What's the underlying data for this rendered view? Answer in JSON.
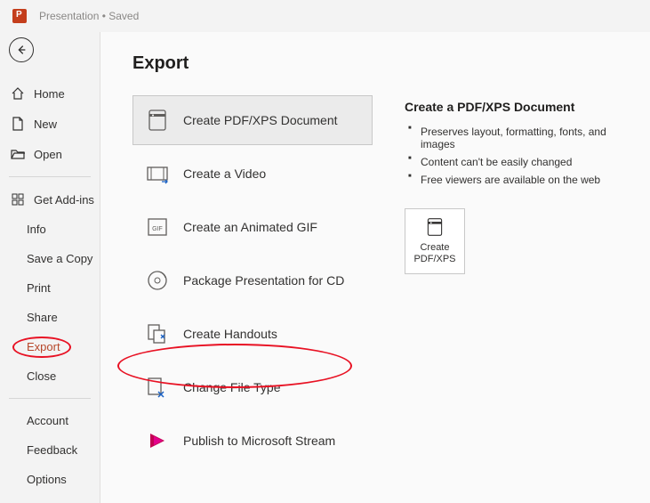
{
  "titlebar": {
    "text": "Presentation • Saved"
  },
  "sidebar": {
    "primary": [
      {
        "label": "Home"
      },
      {
        "label": "New"
      },
      {
        "label": "Open"
      }
    ],
    "addins": {
      "label": "Get Add-ins"
    },
    "file": [
      {
        "label": "Info"
      },
      {
        "label": "Save a Copy"
      },
      {
        "label": "Print"
      },
      {
        "label": "Share"
      },
      {
        "label": "Export"
      },
      {
        "label": "Close"
      }
    ],
    "footer": [
      {
        "label": "Account"
      },
      {
        "label": "Feedback"
      },
      {
        "label": "Options"
      }
    ]
  },
  "page": {
    "title": "Export"
  },
  "exportOptions": [
    {
      "label": "Create PDF/XPS Document"
    },
    {
      "label": "Create a Video"
    },
    {
      "label": "Create an Animated GIF"
    },
    {
      "label": "Package Presentation for CD"
    },
    {
      "label": "Create Handouts"
    },
    {
      "label": "Change File Type"
    },
    {
      "label": "Publish to Microsoft Stream"
    }
  ],
  "detail": {
    "title": "Create a PDF/XPS Document",
    "bullets": [
      "Preserves layout, formatting, fonts, and images",
      "Content can't be easily changed",
      "Free viewers are available on the web"
    ],
    "action": {
      "line1": "Create",
      "line2": "PDF/XPS"
    }
  }
}
